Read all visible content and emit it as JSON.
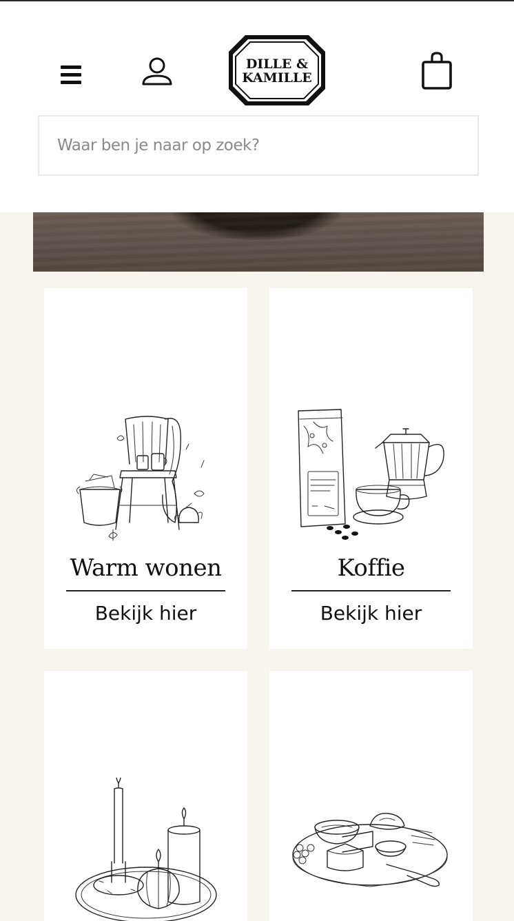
{
  "header": {
    "menu_icon": "hamburger-menu-icon",
    "account_icon": "user-icon",
    "logo_text": "DILLE & KAMILLE",
    "cart_icon": "shopping-bag-icon"
  },
  "search": {
    "placeholder": "Waar ben je naar op zoek?"
  },
  "categories": [
    {
      "title": "Warm wonen",
      "cta": "Bekijk hier"
    },
    {
      "title": "Koffie",
      "cta": "Bekijk hier"
    },
    {
      "title": "",
      "cta": ""
    },
    {
      "title": "",
      "cta": ""
    }
  ],
  "colors": {
    "page_background": "#f8f5ee",
    "header_background": "#ffffff",
    "text": "#111111"
  }
}
